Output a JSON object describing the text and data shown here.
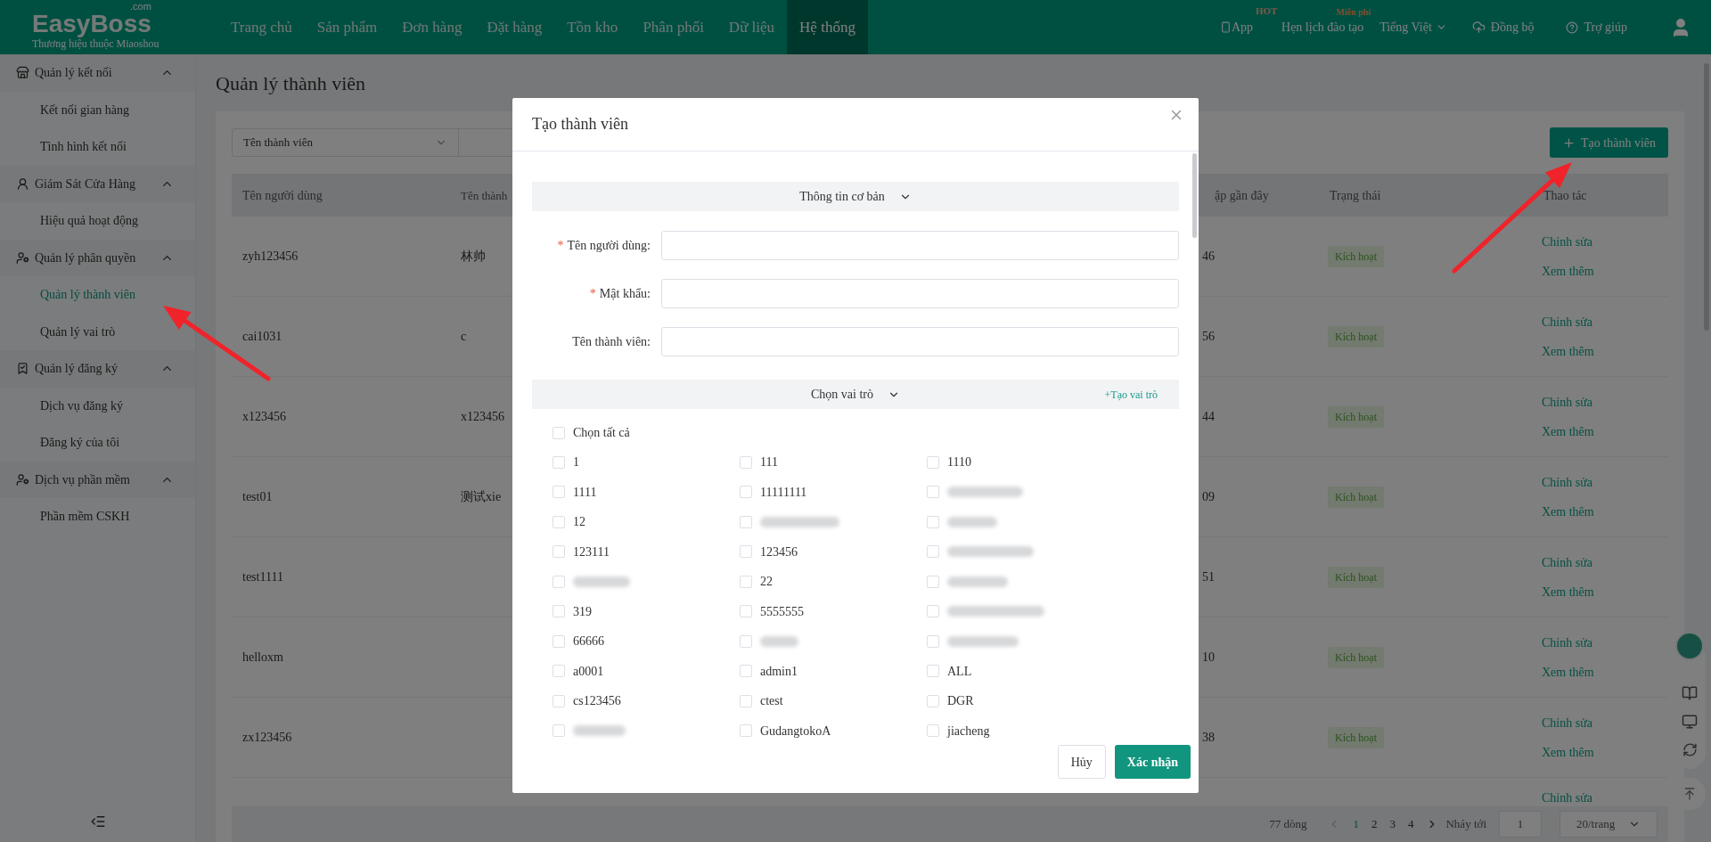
{
  "header": {
    "logo": "EasyBoss",
    "logo_suffix": ".com",
    "tagline": "Thương hiệu thuộc Miaoshou",
    "nav": [
      {
        "label": "Trang chủ",
        "selected": false
      },
      {
        "label": "Sản phẩm",
        "selected": false
      },
      {
        "label": "Đơn hàng",
        "selected": false
      },
      {
        "label": "Đặt hàng",
        "selected": false
      },
      {
        "label": "Tồn kho",
        "selected": false
      },
      {
        "label": "Phân phối",
        "selected": false
      },
      {
        "label": "Dữ liệu",
        "selected": false
      },
      {
        "label": "Hệ thống",
        "selected": true
      }
    ],
    "app": {
      "label": "App",
      "badge": "HOT"
    },
    "training": {
      "label": "Hẹn lịch đào tạo",
      "badge": "Miễn phí"
    },
    "language": "Tiếng Việt",
    "sync": "Đồng bộ",
    "help": "Trợ giúp"
  },
  "sidebar": {
    "groups": [
      {
        "label": "Quản lý kết nối",
        "expanded": true,
        "items": [
          {
            "label": "Kết nối gian hàng",
            "selected": false
          },
          {
            "label": "Tình hình kết nối",
            "selected": false
          }
        ]
      },
      {
        "label": "Giám Sát Cửa Hàng",
        "expanded": true,
        "items": [
          {
            "label": "Hiệu quả hoạt động",
            "selected": false
          }
        ]
      },
      {
        "label": "Quản lý phân quyền",
        "expanded": true,
        "items": [
          {
            "label": "Quản lý thành viên",
            "selected": true
          },
          {
            "label": "Quản lý vai trò",
            "selected": false
          }
        ]
      },
      {
        "label": "Quản lý đăng ký",
        "expanded": true,
        "items": [
          {
            "label": "Dịch vụ đăng ký",
            "selected": false
          },
          {
            "label": "Đăng ký của tôi",
            "selected": false
          }
        ]
      },
      {
        "label": "Dịch vụ phần mềm",
        "expanded": true,
        "items": [
          {
            "label": "Phần mềm CSKH",
            "selected": false
          }
        ]
      }
    ]
  },
  "page": {
    "title": "Quản lý thành viên",
    "filter": {
      "value": "Tên thành viên"
    },
    "create_button": "Tạo thành viên",
    "table": {
      "columns": [
        "Tên người dùng",
        "Tên thành",
        "ập gần đây",
        "Trạng thái",
        "Thao tác"
      ],
      "rows": [
        {
          "username": "zyh123456",
          "member": "林帅",
          "column_3": "46",
          "status": "Kích hoạt",
          "actions": [
            "Chỉnh sửa",
            "Xem thêm"
          ]
        },
        {
          "username": "cai1031",
          "member": "c",
          "column_3": "56",
          "status": "Kích hoạt",
          "actions": [
            "Chỉnh sửa",
            "Xem thêm"
          ]
        },
        {
          "username": "x123456",
          "member": "x123456",
          "column_3": "44",
          "status": "Kích hoạt",
          "actions": [
            "Chỉnh sửa",
            "Xem thêm"
          ]
        },
        {
          "username": "test01",
          "member": "测试xie",
          "column_3": "09",
          "status": "Kích hoạt",
          "actions": [
            "Chỉnh sửa",
            "Xem thêm"
          ]
        },
        {
          "username": "test1111",
          "column_3": "51",
          "status": "Kích hoạt",
          "actions": [
            "Chỉnh sửa",
            "Xem thêm"
          ]
        },
        {
          "username": "helloxm",
          "column_3": "10",
          "status": "Kích hoạt",
          "actions": [
            "Chỉnh sửa",
            "Xem thêm"
          ]
        },
        {
          "username": "zx123456",
          "column_3": "38",
          "status": "Kích hoạt",
          "actions": [
            "Chỉnh sửa",
            "Xem thêm"
          ]
        },
        {
          "actions": [
            "Chỉnh sửa"
          ]
        }
      ]
    },
    "pagination": {
      "total": "77 dòng",
      "pages": [
        {
          "label": "1",
          "selected": true
        },
        {
          "label": "2",
          "selected": false
        },
        {
          "label": "3",
          "selected": false
        },
        {
          "label": "4",
          "selected": false
        }
      ],
      "jump_label": "Nháy tới",
      "jump_value": "1",
      "page_size": "20/trang"
    }
  },
  "dialog": {
    "title": "Tạo thành viên",
    "basic_section": "Thông tin cơ bản",
    "fields": [
      {
        "label": "Tên người dùng:",
        "required_mark": "*"
      },
      {
        "label": "Mật khẩu:",
        "required_mark": "*"
      },
      {
        "label": "Tên thành viên:"
      }
    ],
    "roles_section": "Chọn vai trò",
    "create_role_link": "+Tạo vai trò",
    "select_all": {
      "label": "Chọn tất cả",
      "checked": false
    },
    "roles": [
      {
        "kind": "text",
        "label": "1",
        "checked": false
      },
      {
        "kind": "text",
        "label": "111",
        "checked": false
      },
      {
        "kind": "text",
        "label": "1110",
        "checked": false
      },
      {
        "kind": "text",
        "label": "1111",
        "checked": false
      },
      {
        "kind": "text",
        "label": "11111111",
        "checked": false
      },
      {
        "kind": "blurred",
        "checked": false
      },
      {
        "kind": "text",
        "label": "12",
        "checked": false
      },
      {
        "kind": "blurred",
        "checked": false
      },
      {
        "kind": "blurred",
        "checked": false
      },
      {
        "kind": "text",
        "label": "123111",
        "checked": false
      },
      {
        "kind": "text",
        "label": "123456",
        "checked": false
      },
      {
        "kind": "blurred",
        "checked": false
      },
      {
        "kind": "blurred",
        "checked": false
      },
      {
        "kind": "text",
        "label": "22",
        "checked": false
      },
      {
        "kind": "blurred",
        "checked": false
      },
      {
        "kind": "text",
        "label": "319",
        "checked": false
      },
      {
        "kind": "text",
        "label": "5555555",
        "checked": false
      },
      {
        "kind": "blurred",
        "checked": false
      },
      {
        "kind": "text",
        "label": "66666",
        "checked": false
      },
      {
        "kind": "blurred",
        "checked": false
      },
      {
        "kind": "blurred",
        "checked": false
      },
      {
        "kind": "text",
        "label": "a0001",
        "checked": false
      },
      {
        "kind": "text",
        "label": "admin1",
        "checked": false
      },
      {
        "kind": "text",
        "label": "ALL",
        "checked": false
      },
      {
        "kind": "text",
        "label": "cs123456",
        "checked": false
      },
      {
        "kind": "text",
        "label": "ctest",
        "checked": false
      },
      {
        "kind": "text",
        "label": "DGR",
        "checked": false
      },
      {
        "kind": "blurred",
        "checked": false
      },
      {
        "kind": "text",
        "label": "GudangtokoA",
        "checked": false
      },
      {
        "kind": "text",
        "label": "jiacheng",
        "checked": false
      }
    ],
    "cancel": "Hủy",
    "confirm": "Xác nhận"
  }
}
